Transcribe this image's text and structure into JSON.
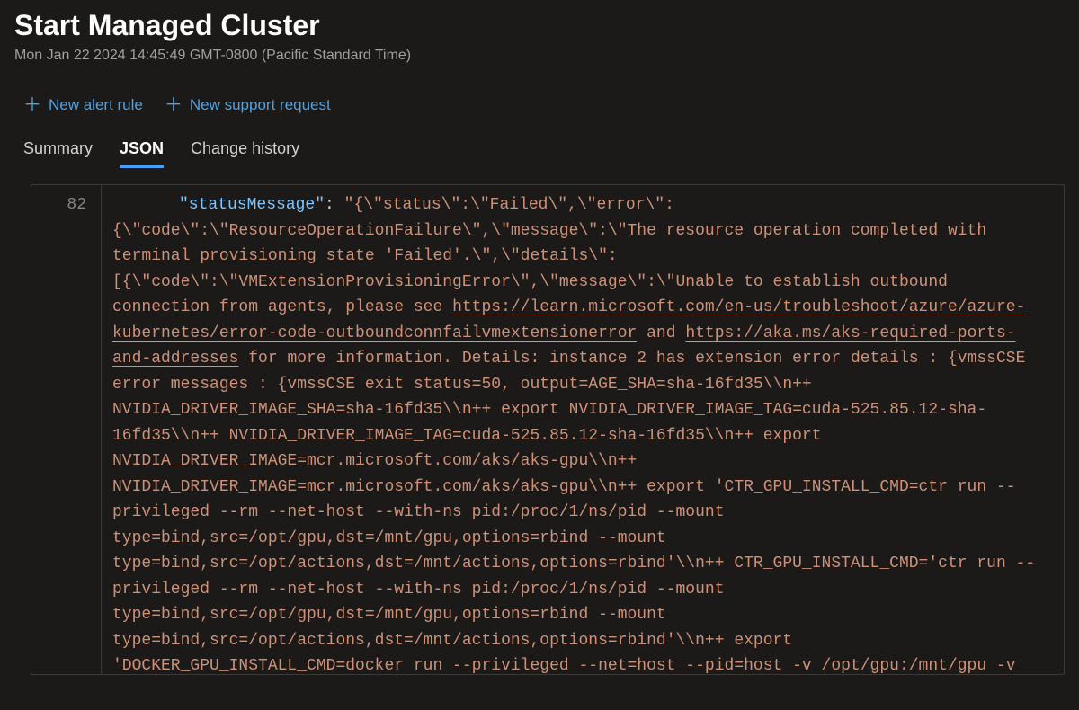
{
  "header": {
    "title": "Start Managed Cluster",
    "timestamp": "Mon Jan 22 2024 14:45:49 GMT-0800 (Pacific Standard Time)"
  },
  "toolbar": {
    "new_alert_rule": "New alert rule",
    "new_support_request": "New support request"
  },
  "tabs": {
    "summary": "Summary",
    "json": "JSON",
    "change_history": "Change history",
    "active": "json"
  },
  "code": {
    "line_number": "82",
    "key": "\"statusMessage\"",
    "seg_before_link1": "\"{\\\"status\\\":\\\"Failed\\\",\\\"error\\\":{\\\"code\\\":\\\"ResourceOperationFailure\\\",\\\"message\\\":\\\"The resource operation completed with terminal provisioning state 'Failed'.\\\",\\\"details\\\":[{\\\"code\\\":\\\"VMExtensionProvisioningError\\\",\\\"message\\\":\\\"Unable to establish outbound connection from agents, please see ",
    "link1": "https://learn.microsoft.com/en-us/troubleshoot/azure/azure-kubernetes/error-code-outboundconnfailvmextensionerror",
    "between_links": " and ",
    "link2": "https://aka.ms/aks-required-ports-and-addresses",
    "seg_after_link2": " for more information. Details: instance 2 has extension error details : {vmssCSE error messages : {vmssCSE exit status=50, output=AGE_SHA=sha-16fd35\\\\n++ NVIDIA_DRIVER_IMAGE_SHA=sha-16fd35\\\\n++ export NVIDIA_DRIVER_IMAGE_TAG=cuda-525.85.12-sha-16fd35\\\\n++ NVIDIA_DRIVER_IMAGE_TAG=cuda-525.85.12-sha-16fd35\\\\n++ export NVIDIA_DRIVER_IMAGE=mcr.microsoft.com/aks/aks-gpu\\\\n++ NVIDIA_DRIVER_IMAGE=mcr.microsoft.com/aks/aks-gpu\\\\n++ export 'CTR_GPU_INSTALL_CMD=ctr run --privileged --rm --net-host --with-ns pid:/proc/1/ns/pid --mount type=bind,src=/opt/gpu,dst=/mnt/gpu,options=rbind --mount type=bind,src=/opt/actions,dst=/mnt/actions,options=rbind'\\\\n++ CTR_GPU_INSTALL_CMD='ctr run --privileged --rm --net-host --with-ns pid:/proc/1/ns/pid --mount type=bind,src=/opt/gpu,dst=/mnt/gpu,options=rbind --mount type=bind,src=/opt/actions,dst=/mnt/actions,options=rbind'\\\\n++ export 'DOCKER_GPU_INSTALL_CMD=docker run --privileged --net=host --pid=host -v /opt/gpu:/mnt/gpu -v /opt/actions:/mnt/actions --rm'\\\\n++ DOCKER_GPU_INSTALL_CMD='docker run --privileged"
  }
}
